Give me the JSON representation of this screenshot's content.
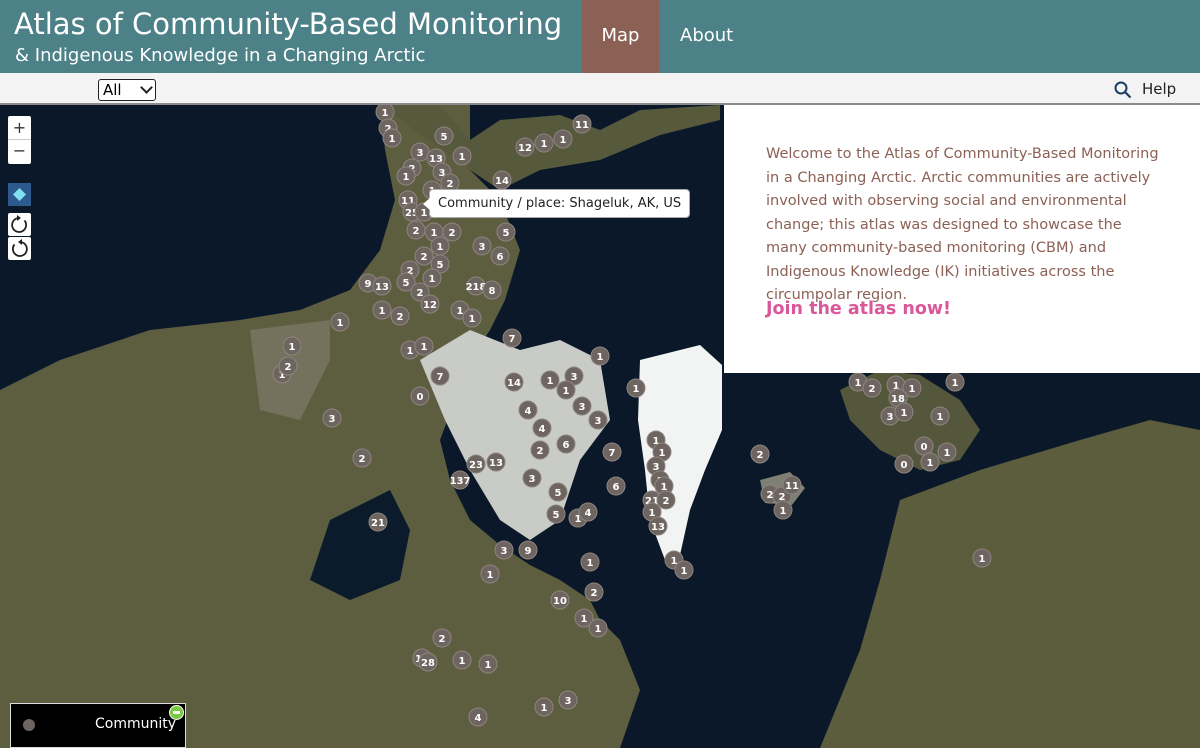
{
  "header": {
    "title": "Atlas of Community-Based Monitoring",
    "subtitle": "& Indigenous Knowledge in a Changing Arctic",
    "nav": [
      {
        "label": "Map",
        "active": true
      },
      {
        "label": "About",
        "active": false
      }
    ]
  },
  "toolbar": {
    "filter_value": "All",
    "help_label": "Help",
    "search_icon": "search-icon"
  },
  "map": {
    "zoom_in_label": "+",
    "zoom_out_label": "−",
    "tooltip": "Community / place: Shageluk, AK, US",
    "cluster_color": "#6f6560",
    "clusters": [
      {
        "label": "1"
      },
      {
        "label": "2"
      },
      {
        "label": "1"
      },
      {
        "label": "5"
      },
      {
        "label": "3"
      },
      {
        "label": "13"
      },
      {
        "label": "1"
      },
      {
        "label": "12"
      },
      {
        "label": "1"
      },
      {
        "label": "1"
      },
      {
        "label": "11"
      },
      {
        "label": "2"
      },
      {
        "label": "1"
      },
      {
        "label": "3"
      },
      {
        "label": "14"
      },
      {
        "label": "1"
      },
      {
        "label": "2"
      },
      {
        "label": "11"
      },
      {
        "label": "25"
      },
      {
        "label": "1"
      },
      {
        "label": "2"
      },
      {
        "label": "1"
      },
      {
        "label": "2"
      },
      {
        "label": "5"
      },
      {
        "label": "2"
      },
      {
        "label": "1"
      },
      {
        "label": "3"
      },
      {
        "label": "6"
      },
      {
        "label": "2"
      },
      {
        "label": "5"
      },
      {
        "label": "9"
      },
      {
        "label": "13"
      },
      {
        "label": "5"
      },
      {
        "label": "1"
      },
      {
        "label": "2"
      },
      {
        "label": "218"
      },
      {
        "label": "8"
      },
      {
        "label": "1"
      },
      {
        "label": "2"
      },
      {
        "label": "12"
      },
      {
        "label": "1"
      },
      {
        "label": "1"
      },
      {
        "label": "1"
      },
      {
        "label": "1"
      },
      {
        "label": "7"
      },
      {
        "label": "1"
      },
      {
        "label": "2"
      },
      {
        "label": "1"
      },
      {
        "label": "1"
      },
      {
        "label": "1"
      },
      {
        "label": "7"
      },
      {
        "label": "0"
      },
      {
        "label": "3"
      },
      {
        "label": "2"
      },
      {
        "label": "3"
      },
      {
        "label": "14"
      },
      {
        "label": "1"
      },
      {
        "label": "1"
      },
      {
        "label": "3"
      },
      {
        "label": "1"
      },
      {
        "label": "4"
      },
      {
        "label": "3"
      },
      {
        "label": "4"
      },
      {
        "label": "6"
      },
      {
        "label": "2"
      },
      {
        "label": "7"
      },
      {
        "label": "23"
      },
      {
        "label": "13"
      },
      {
        "label": "137"
      },
      {
        "label": "3"
      },
      {
        "label": "5"
      },
      {
        "label": "6"
      },
      {
        "label": "5"
      },
      {
        "label": "1"
      },
      {
        "label": "4"
      },
      {
        "label": "21"
      },
      {
        "label": "3"
      },
      {
        "label": "9"
      },
      {
        "label": "1"
      },
      {
        "label": "1"
      },
      {
        "label": "2"
      },
      {
        "label": "10"
      },
      {
        "label": "1"
      },
      {
        "label": "1"
      },
      {
        "label": "1"
      },
      {
        "label": "1"
      },
      {
        "label": "1"
      },
      {
        "label": "3"
      },
      {
        "label": "1"
      },
      {
        "label": "1"
      },
      {
        "label": "21"
      },
      {
        "label": "2"
      },
      {
        "label": "1"
      },
      {
        "label": "13"
      },
      {
        "label": "1"
      },
      {
        "label": "2"
      },
      {
        "label": "2"
      },
      {
        "label": "2"
      },
      {
        "label": "11"
      },
      {
        "label": "1"
      },
      {
        "label": "1"
      },
      {
        "label": "1"
      },
      {
        "label": "2"
      },
      {
        "label": "1"
      },
      {
        "label": "1"
      },
      {
        "label": "1"
      },
      {
        "label": "18"
      },
      {
        "label": "3"
      },
      {
        "label": "1"
      },
      {
        "label": "1"
      },
      {
        "label": "0"
      },
      {
        "label": "0"
      },
      {
        "label": "1"
      },
      {
        "label": "1"
      },
      {
        "label": "2"
      },
      {
        "label": "17"
      },
      {
        "label": "28"
      },
      {
        "label": "1"
      },
      {
        "label": "1"
      },
      {
        "label": "4"
      },
      {
        "label": "1"
      },
      {
        "label": "3"
      }
    ]
  },
  "welcome": {
    "text": "Welcome to the Atlas of Community-Based Monitoring in a Changing Arctic. Arctic communities are actively involved with observing social and environmental change; this atlas was designed to showcase the many community-based monitoring (CBM) and Indigenous Knowledge (IK) initiatives across the circumpolar region.",
    "join_label": "Join the atlas now!"
  },
  "legend": {
    "label": "Community"
  }
}
